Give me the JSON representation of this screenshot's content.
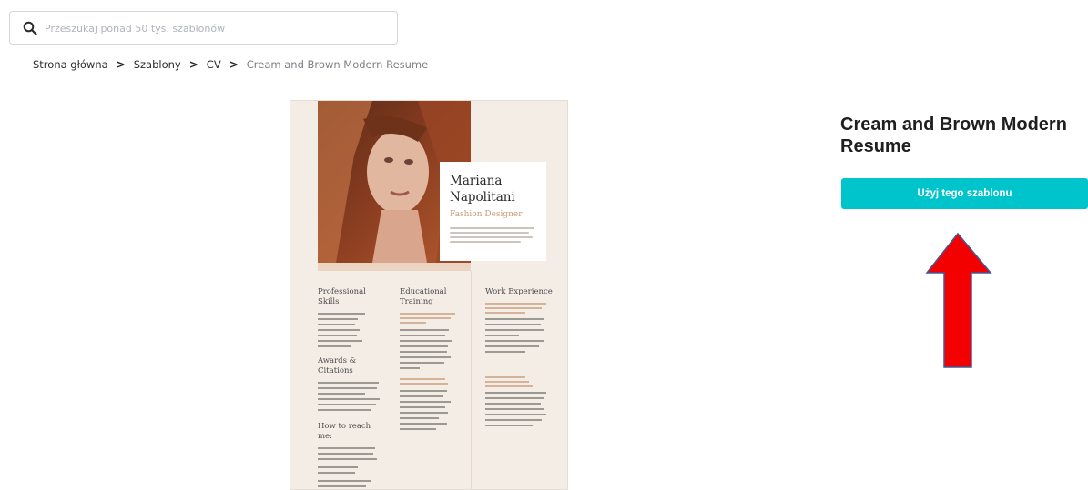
{
  "search": {
    "placeholder": "Przeszukaj ponad 50 tys. szablonów"
  },
  "breadcrumb": {
    "items": [
      "Strona główna",
      "Szablony",
      "CV"
    ],
    "current": "Cream and Brown Modern Resume",
    "separator": ">"
  },
  "resume_preview": {
    "name_line1": "Mariana",
    "name_line2": "Napolitani",
    "role": "Fashion Designer",
    "sections": {
      "col1_heading1": "Professional Skills",
      "col1_heading2": "Awards & Citations",
      "col1_heading3": "How to reach me:",
      "col2_heading1": "Educational",
      "col2_heading2": "Training",
      "col3_heading1": "Work Experience"
    }
  },
  "template": {
    "title": "Cream and Brown Modern Resume",
    "use_button": "Użyj tego szablonu"
  },
  "colors": {
    "accent": "#00c4cc",
    "arrow_fill": "#f30000",
    "arrow_stroke": "#3d5a9c",
    "resume_bg": "#f4ede6"
  }
}
